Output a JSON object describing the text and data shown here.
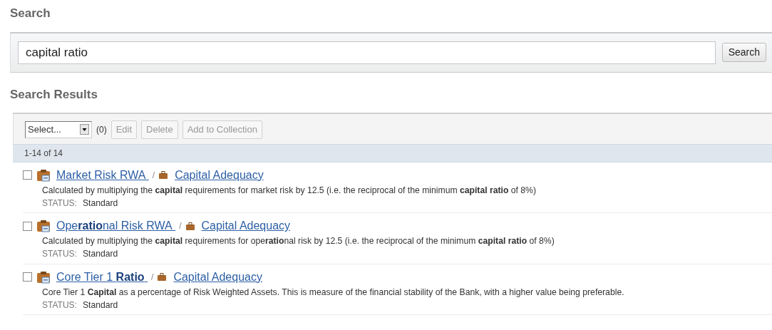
{
  "search_heading": "Search",
  "search": {
    "value": "capital ratio",
    "button": "Search"
  },
  "results_heading": "Search Results",
  "toolbar": {
    "select": "Select...",
    "count": "(0)",
    "buttons": [
      {
        "label": "Edit",
        "disabled": true
      },
      {
        "label": "Delete",
        "disabled": true
      },
      {
        "label": "Add to Collection",
        "disabled": true
      }
    ]
  },
  "range": "1-14 of 14",
  "results": [
    {
      "title": "Market Risk RWA",
      "separator": "/",
      "collection": "Capital Adequacy",
      "checked": false,
      "description": "Calculated by multiplying the **capital** requirements for market risk by 12.5 (i.e. the reciprocal of the minimum **capital ratio** of 8%)",
      "status_label": "STATUS:",
      "status": "Standard"
    },
    {
      "title": "Ope**ratio**nal Risk RWA",
      "separator": "/",
      "collection": "Capital Adequacy",
      "checked": false,
      "description": "Calculated by multiplying the **capital** requirements for ope**ratio**nal risk by 12.5 (i.e. the reciprocal of the minimum **capital ratio** of 8%)",
      "status_label": "STATUS:",
      "status": "Standard"
    },
    {
      "title": "Core Tier 1 **Ratio**",
      "separator": "/",
      "collection": "Capital Adequacy",
      "checked": false,
      "description": "Core Tier 1 **Capital** as a percentage of Risk Weighted Assets. This is measure of the financial stability of the Bank, with a higher value being preferable.",
      "status_label": "STATUS:",
      "status": "Standard"
    }
  ]
}
